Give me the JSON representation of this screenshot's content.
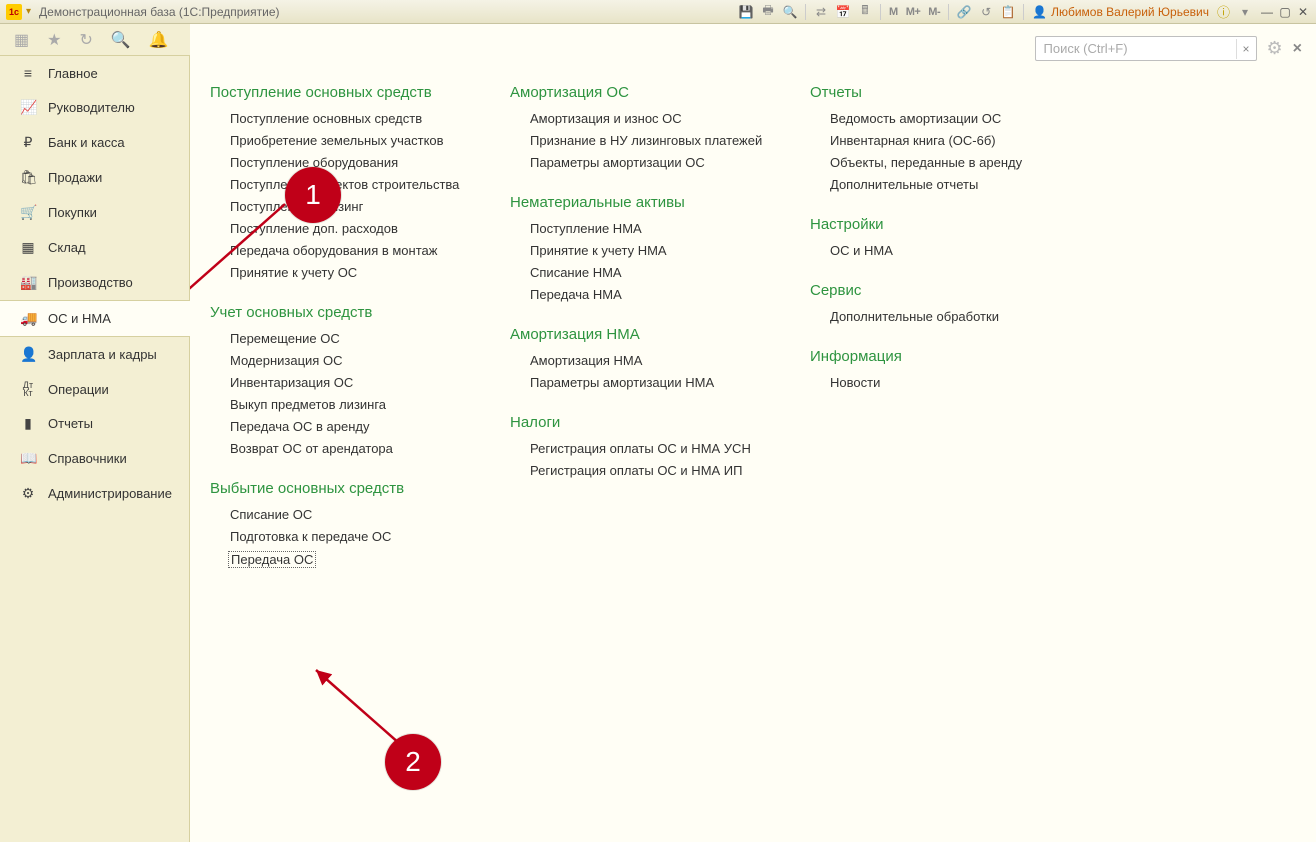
{
  "titlebar": {
    "app_logo_text": "1c",
    "title": "Демонстрационная база  (1С:Предприятие)",
    "user_name": "Любимов Валерий Юрьевич",
    "m_labels": [
      "M",
      "M+",
      "M-"
    ]
  },
  "search": {
    "placeholder": "Поиск (Ctrl+F)",
    "value": ""
  },
  "sidebar": {
    "items": [
      {
        "icon": "menu",
        "label": "Главное"
      },
      {
        "icon": "chart",
        "label": "Руководителю"
      },
      {
        "icon": "ruble",
        "label": "Банк и касса"
      },
      {
        "icon": "bag",
        "label": "Продажи"
      },
      {
        "icon": "cart",
        "label": "Покупки"
      },
      {
        "icon": "warehouse",
        "label": "Склад"
      },
      {
        "icon": "factory",
        "label": "Производство"
      },
      {
        "icon": "truck",
        "label": "ОС и НМА",
        "active": true
      },
      {
        "icon": "person",
        "label": "Зарплата и кадры"
      },
      {
        "icon": "dtk",
        "label": "Операции"
      },
      {
        "icon": "bars",
        "label": "Отчеты"
      },
      {
        "icon": "book",
        "label": "Справочники"
      },
      {
        "icon": "gear",
        "label": "Администрирование"
      }
    ]
  },
  "columns": [
    [
      {
        "header": "Поступление основных средств",
        "items": [
          "Поступление основных средств",
          "Приобретение земельных участков",
          "Поступление оборудования",
          "Поступление объектов строительства",
          "Поступление в лизинг",
          "Поступление доп. расходов",
          "Передача оборудования в монтаж",
          "Принятие к учету ОС"
        ]
      },
      {
        "header": "Учет основных средств",
        "items": [
          "Перемещение ОС",
          "Модернизация ОС",
          "Инвентаризация ОС",
          "Выкуп предметов лизинга",
          "Передача ОС в аренду",
          "Возврат ОС от арендатора"
        ]
      },
      {
        "header": "Выбытие основных средств",
        "items": [
          "Списание ОС",
          "Подготовка к передаче ОС",
          "Передача ОС"
        ],
        "selected_index": 2
      }
    ],
    [
      {
        "header": "Амортизация ОС",
        "items": [
          "Амортизация и износ ОС",
          "Признание в НУ лизинговых платежей",
          "Параметры амортизации ОС"
        ]
      },
      {
        "header": "Нематериальные активы",
        "items": [
          "Поступление НМА",
          "Принятие к учету НМА",
          "Списание НМА",
          "Передача НМА"
        ]
      },
      {
        "header": "Амортизация НМА",
        "items": [
          "Амортизация НМА",
          "Параметры амортизации НМА"
        ]
      },
      {
        "header": "Налоги",
        "items": [
          "Регистрация оплаты ОС и НМА УСН",
          "Регистрация оплаты ОС и НМА ИП"
        ]
      }
    ],
    [
      {
        "header": "Отчеты",
        "items": [
          "Ведомость амортизации ОС",
          "Инвентарная книга (ОС-6б)",
          "Объекты, переданные в аренду",
          "Дополнительные отчеты"
        ]
      },
      {
        "header": "Настройки",
        "items": [
          "ОС и НМА"
        ]
      },
      {
        "header": "Сервис",
        "items": [
          "Дополнительные обработки"
        ]
      },
      {
        "header": "Информация",
        "items": [
          "Новости"
        ]
      }
    ]
  ],
  "annotations": {
    "circle1": "1",
    "circle2": "2"
  }
}
